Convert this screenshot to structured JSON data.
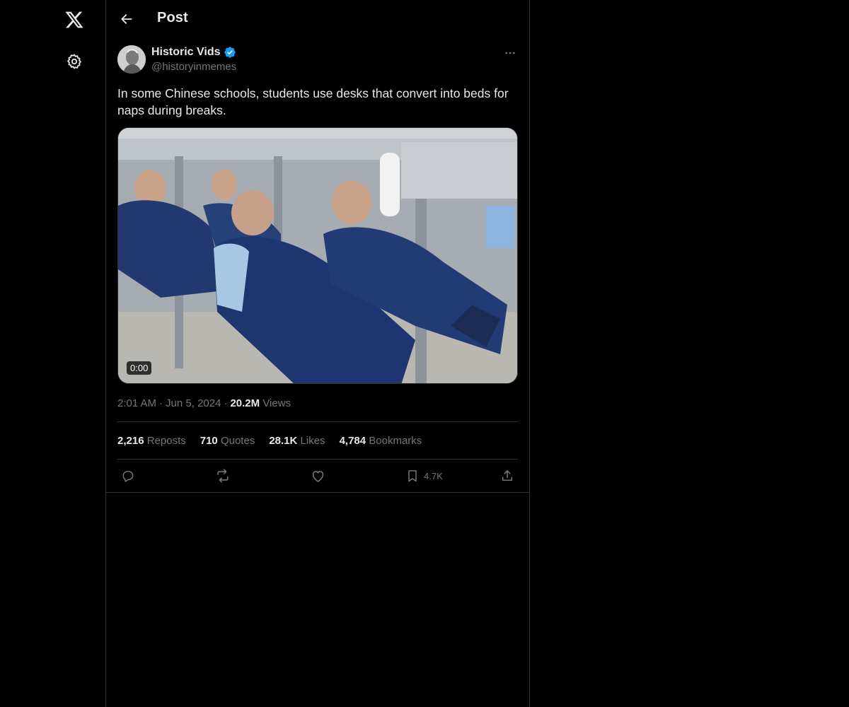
{
  "header": {
    "title": "Post"
  },
  "post": {
    "author_name": "Historic Vids",
    "author_handle": "@historyinmemes",
    "text": "In some Chinese schools, students use desks that convert into beds for naps during breaks.",
    "video_time": "0:00",
    "time": "2:01 AM",
    "date": "Jun 5, 2024",
    "views_count": "20.2M",
    "views_label": "Views",
    "stats": [
      {
        "count": "2,216",
        "label": "Reposts"
      },
      {
        "count": "710",
        "label": "Quotes"
      },
      {
        "count": "28.1K",
        "label": "Likes"
      },
      {
        "count": "4,784",
        "label": "Bookmarks"
      }
    ],
    "bookmark_count": "4.7K"
  },
  "icons": {
    "logo": "x-logo-icon",
    "settings": "gear-icon",
    "back": "arrow-left-icon",
    "verified": "verified-badge-icon",
    "more": "more-horizontal-icon",
    "reply": "reply-icon",
    "repost": "repost-icon",
    "like": "heart-icon",
    "bookmark": "bookmark-icon",
    "share": "share-icon"
  },
  "colors": {
    "background": "#000000",
    "text": "#e7e9ea",
    "muted": "#71767b",
    "border": "#2f3336",
    "verified": "#1d9bf0"
  }
}
